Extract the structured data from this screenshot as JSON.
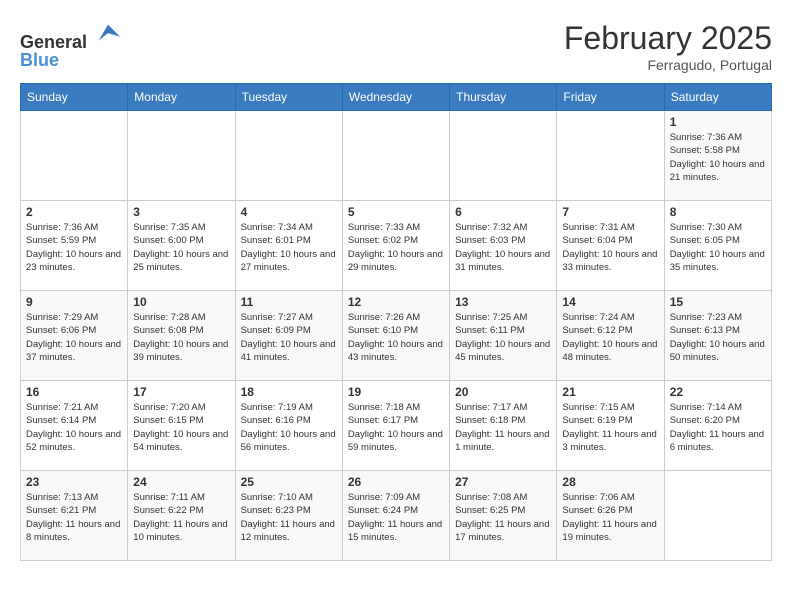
{
  "header": {
    "logo_line1": "General",
    "logo_line2": "Blue",
    "month": "February 2025",
    "location": "Ferragudo, Portugal"
  },
  "weekdays": [
    "Sunday",
    "Monday",
    "Tuesday",
    "Wednesday",
    "Thursday",
    "Friday",
    "Saturday"
  ],
  "weeks": [
    [
      {
        "day": "",
        "info": ""
      },
      {
        "day": "",
        "info": ""
      },
      {
        "day": "",
        "info": ""
      },
      {
        "day": "",
        "info": ""
      },
      {
        "day": "",
        "info": ""
      },
      {
        "day": "",
        "info": ""
      },
      {
        "day": "1",
        "info": "Sunrise: 7:36 AM\nSunset: 5:58 PM\nDaylight: 10 hours and 21 minutes."
      }
    ],
    [
      {
        "day": "2",
        "info": "Sunrise: 7:36 AM\nSunset: 5:59 PM\nDaylight: 10 hours and 23 minutes."
      },
      {
        "day": "3",
        "info": "Sunrise: 7:35 AM\nSunset: 6:00 PM\nDaylight: 10 hours and 25 minutes."
      },
      {
        "day": "4",
        "info": "Sunrise: 7:34 AM\nSunset: 6:01 PM\nDaylight: 10 hours and 27 minutes."
      },
      {
        "day": "5",
        "info": "Sunrise: 7:33 AM\nSunset: 6:02 PM\nDaylight: 10 hours and 29 minutes."
      },
      {
        "day": "6",
        "info": "Sunrise: 7:32 AM\nSunset: 6:03 PM\nDaylight: 10 hours and 31 minutes."
      },
      {
        "day": "7",
        "info": "Sunrise: 7:31 AM\nSunset: 6:04 PM\nDaylight: 10 hours and 33 minutes."
      },
      {
        "day": "8",
        "info": "Sunrise: 7:30 AM\nSunset: 6:05 PM\nDaylight: 10 hours and 35 minutes."
      }
    ],
    [
      {
        "day": "9",
        "info": "Sunrise: 7:29 AM\nSunset: 6:06 PM\nDaylight: 10 hours and 37 minutes."
      },
      {
        "day": "10",
        "info": "Sunrise: 7:28 AM\nSunset: 6:08 PM\nDaylight: 10 hours and 39 minutes."
      },
      {
        "day": "11",
        "info": "Sunrise: 7:27 AM\nSunset: 6:09 PM\nDaylight: 10 hours and 41 minutes."
      },
      {
        "day": "12",
        "info": "Sunrise: 7:26 AM\nSunset: 6:10 PM\nDaylight: 10 hours and 43 minutes."
      },
      {
        "day": "13",
        "info": "Sunrise: 7:25 AM\nSunset: 6:11 PM\nDaylight: 10 hours and 45 minutes."
      },
      {
        "day": "14",
        "info": "Sunrise: 7:24 AM\nSunset: 6:12 PM\nDaylight: 10 hours and 48 minutes."
      },
      {
        "day": "15",
        "info": "Sunrise: 7:23 AM\nSunset: 6:13 PM\nDaylight: 10 hours and 50 minutes."
      }
    ],
    [
      {
        "day": "16",
        "info": "Sunrise: 7:21 AM\nSunset: 6:14 PM\nDaylight: 10 hours and 52 minutes."
      },
      {
        "day": "17",
        "info": "Sunrise: 7:20 AM\nSunset: 6:15 PM\nDaylight: 10 hours and 54 minutes."
      },
      {
        "day": "18",
        "info": "Sunrise: 7:19 AM\nSunset: 6:16 PM\nDaylight: 10 hours and 56 minutes."
      },
      {
        "day": "19",
        "info": "Sunrise: 7:18 AM\nSunset: 6:17 PM\nDaylight: 10 hours and 59 minutes."
      },
      {
        "day": "20",
        "info": "Sunrise: 7:17 AM\nSunset: 6:18 PM\nDaylight: 11 hours and 1 minute."
      },
      {
        "day": "21",
        "info": "Sunrise: 7:15 AM\nSunset: 6:19 PM\nDaylight: 11 hours and 3 minutes."
      },
      {
        "day": "22",
        "info": "Sunrise: 7:14 AM\nSunset: 6:20 PM\nDaylight: 11 hours and 6 minutes."
      }
    ],
    [
      {
        "day": "23",
        "info": "Sunrise: 7:13 AM\nSunset: 6:21 PM\nDaylight: 11 hours and 8 minutes."
      },
      {
        "day": "24",
        "info": "Sunrise: 7:11 AM\nSunset: 6:22 PM\nDaylight: 11 hours and 10 minutes."
      },
      {
        "day": "25",
        "info": "Sunrise: 7:10 AM\nSunset: 6:23 PM\nDaylight: 11 hours and 12 minutes."
      },
      {
        "day": "26",
        "info": "Sunrise: 7:09 AM\nSunset: 6:24 PM\nDaylight: 11 hours and 15 minutes."
      },
      {
        "day": "27",
        "info": "Sunrise: 7:08 AM\nSunset: 6:25 PM\nDaylight: 11 hours and 17 minutes."
      },
      {
        "day": "28",
        "info": "Sunrise: 7:06 AM\nSunset: 6:26 PM\nDaylight: 11 hours and 19 minutes."
      },
      {
        "day": "",
        "info": ""
      }
    ]
  ]
}
